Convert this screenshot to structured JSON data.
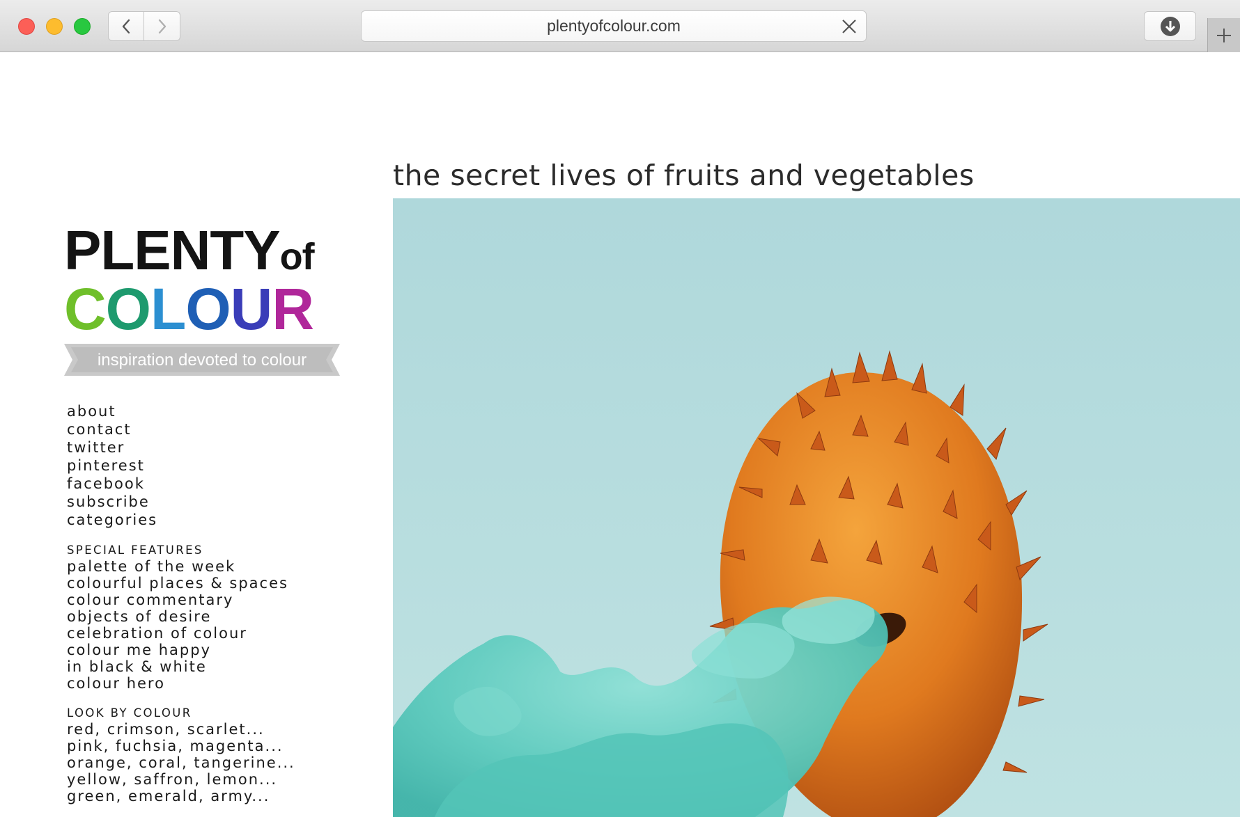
{
  "browser": {
    "url": "plentyofcolour.com"
  },
  "logo": {
    "line1": "PLENTY",
    "of": "of",
    "line2_letters": [
      "C",
      "O",
      "L",
      "O",
      "U",
      "R"
    ],
    "tagline": "inspiration devoted to colour"
  },
  "post": {
    "title": "the secret lives of fruits and vegetables"
  },
  "nav": {
    "main": [
      "about",
      "contact",
      "twitter",
      "pinterest",
      "facebook",
      "subscribe",
      "categories"
    ],
    "special_heading": "SPECIAL FEATURES",
    "special": [
      "palette of the week",
      "colourful places & spaces",
      "colour commentary",
      "objects of desire",
      "celebration of colour",
      "colour me happy",
      "in black & white",
      "colour hero"
    ],
    "colour_heading": "LOOK BY COLOUR",
    "colours": [
      "red, crimson, scarlet...",
      "pink, fuchsia, magenta...",
      "orange, coral, tangerine...",
      "yellow, saffron, lemon...",
      "green, emerald, army..."
    ]
  },
  "colors": {
    "hero_background": "#b5dcdf",
    "fruit": "#e0791f",
    "smoke": "#6dcfc4"
  }
}
